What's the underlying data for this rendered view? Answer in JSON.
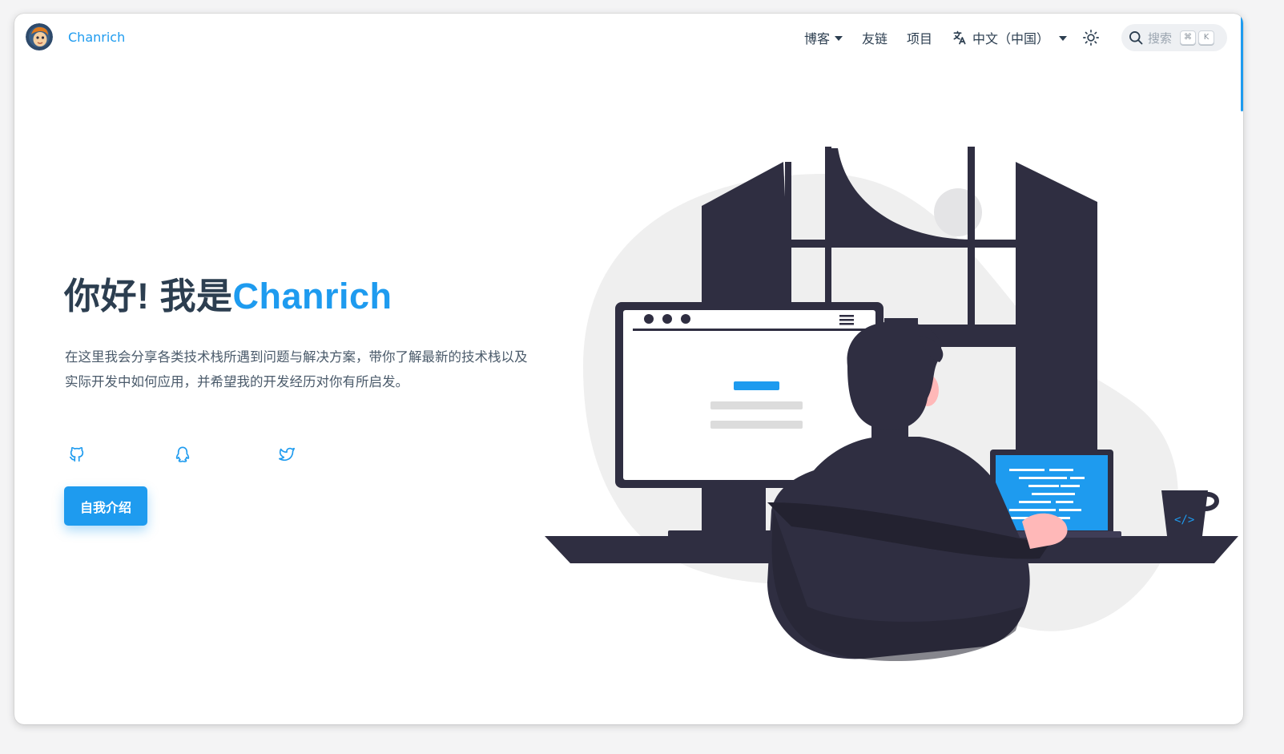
{
  "brand": {
    "name": "Chanrich",
    "avatar_icon": "avatar-icon"
  },
  "nav": {
    "blog": "博客",
    "links": "友链",
    "projects": "项目",
    "language": "中文（中国）",
    "theme_icon": "sun-icon",
    "search_placeholder": "搜索",
    "search_key_1": "⌘",
    "search_key_2": "K"
  },
  "hero": {
    "title_prefix": "你好! 我是",
    "title_name": "Chanrich",
    "description": "在这里我会分享各类技术栈所遇到问题与解决方案，带你了解最新的技术栈以及实际开发中如何应用，并希望我的开发经历对你有所启发。",
    "socials": [
      "github-icon",
      "qq-icon",
      "twitter-icon"
    ],
    "cta_label": "自我介绍"
  },
  "colors": {
    "accent": "#1e9bef",
    "text": "#2c3e50",
    "illustration_dark": "#2f2e41"
  }
}
